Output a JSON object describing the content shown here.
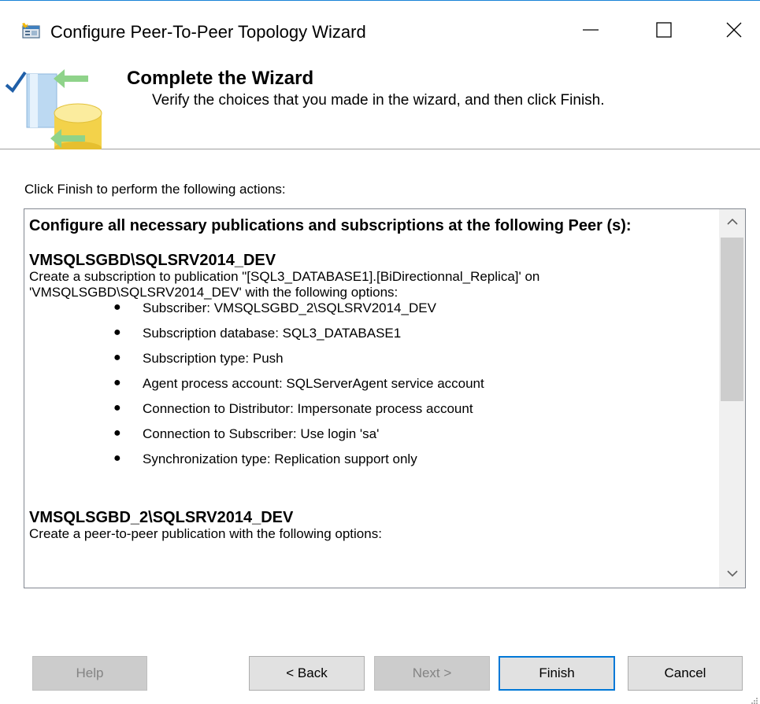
{
  "window": {
    "title": "Configure Peer-To-Peer Topology Wizard",
    "accent_color": "#1883d7",
    "icons": [
      "wizard-app-icon",
      "minimize-icon",
      "maximize-icon",
      "close-icon"
    ]
  },
  "header": {
    "title": "Complete the Wizard",
    "subtitle": "Verify the choices that you made in the wizard, and then click Finish.",
    "graphic_icon": "database-sync-icon"
  },
  "content": {
    "intro": "Click Finish to perform the following actions:",
    "top_heading": "Configure all necessary publications and subscriptions at the following Peer (s):",
    "sections": [
      {
        "server": "VMSQLSGBD\\SQLSRV2014_DEV",
        "description": "Create a subscription to publication \"[SQL3_DATABASE1].[BiDirectionnal_Replica]' on 'VMSQLSGBD\\SQLSRV2014_DEV' with the following options:",
        "options": [
          "Subscriber: VMSQLSGBD_2\\SQLSRV2014_DEV",
          "Subscription database: SQL3_DATABASE1",
          "Subscription type: Push",
          "Agent process account: SQLServerAgent service account",
          "Connection to Distributor: Impersonate process account",
          "Connection to Subscriber: Use login 'sa'",
          "Synchronization type: Replication support only"
        ]
      },
      {
        "server": "VMSQLSGBD_2\\SQLSRV2014_DEV",
        "description": "Create a peer-to-peer publication with the following options:"
      }
    ]
  },
  "buttons": {
    "help": "Help",
    "back": "< Back",
    "next": "Next >",
    "finish": "Finish",
    "cancel": "Cancel"
  }
}
